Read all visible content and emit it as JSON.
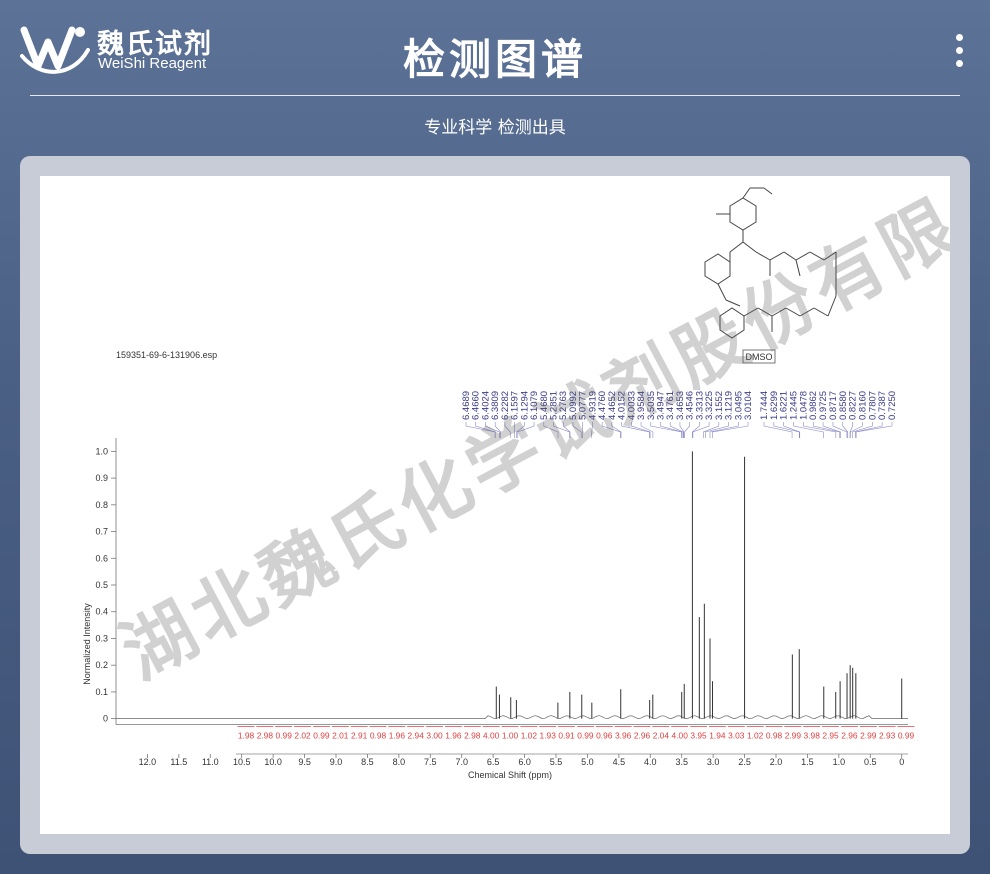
{
  "header": {
    "brand_cn": "魏氏试剂",
    "brand_en": "WeiShi Reagent",
    "title": "检测图谱",
    "subtitle": "专业科学  检测出具"
  },
  "watermark": "湖北魏氏化学试剂股份有限公司",
  "colors": {
    "accent_bg": "#4a5f84",
    "integral": "#e04040",
    "peak_label": "#3a3a8a",
    "spectrum": "#333333"
  },
  "chart_data": {
    "type": "line",
    "file_label": "159351-69-6-131906.esp",
    "xlabel": "Chemical Shift (ppm)",
    "ylabel": "Normalized Intensity",
    "xlim": [
      12.5,
      -0.1
    ],
    "ylim": [
      -0.05,
      1.05
    ],
    "x_ticks": [
      12.0,
      11.5,
      11.0,
      10.5,
      10.0,
      9.5,
      9.0,
      8.5,
      8.0,
      7.5,
      7.0,
      6.5,
      6.0,
      5.5,
      5.0,
      4.5,
      4.0,
      3.5,
      3.0,
      2.5,
      2.0,
      1.5,
      1.0,
      0.5,
      0
    ],
    "y_ticks": [
      0,
      0.1,
      0.2,
      0.3,
      0.4,
      0.5,
      0.6,
      0.7,
      0.8,
      0.9,
      1.0
    ],
    "solvent_label": "DMSO",
    "solvent_shift": 2.5,
    "peak_labels": [
      "6.4689",
      "6.4660",
      "6.4024",
      "6.3809",
      "6.2282",
      "6.1597",
      "6.1294",
      "6.1079",
      "5.4680",
      "5.2851",
      "5.2763",
      "5.0992",
      "5.0777",
      "4.9319",
      "4.4760",
      "4.4652",
      "4.0152",
      "4.0033",
      "3.9584",
      "3.5035",
      "3.4947",
      "3.4761",
      "3.4653",
      "3.4546",
      "3.3313",
      "3.3225",
      "3.1552",
      "3.1219",
      "3.0495",
      "3.0104",
      "1.7444",
      "1.6299",
      "1.6221",
      "1.2445",
      "1.0478",
      "0.9862",
      "0.9725",
      "0.8717",
      "0.8580",
      "0.8227",
      "0.8160",
      "0.7807",
      "0.7387",
      "0.7250"
    ],
    "integrals": [
      "1.98",
      "2.98",
      "0.99",
      "2.02",
      "0.99",
      "2.01",
      "2.91",
      "0.98",
      "1.96",
      "2.94",
      "3.00",
      "1.96",
      "2.98",
      "4.00",
      "1.00",
      "1.02",
      "1.93",
      "0.91",
      "0.99",
      "0.96",
      "3.96",
      "2.96",
      "2.04",
      "4.00",
      "3.95",
      "1.94",
      "3.03",
      "1.02",
      "0.98",
      "2.99",
      "3.98",
      "2.95",
      "2.96",
      "2.99",
      "2.93",
      "0.99"
    ],
    "peaks": [
      {
        "x": 6.45,
        "y": 0.12
      },
      {
        "x": 6.4,
        "y": 0.09
      },
      {
        "x": 6.22,
        "y": 0.08
      },
      {
        "x": 6.13,
        "y": 0.07
      },
      {
        "x": 5.47,
        "y": 0.06
      },
      {
        "x": 5.28,
        "y": 0.1
      },
      {
        "x": 5.09,
        "y": 0.09
      },
      {
        "x": 4.93,
        "y": 0.06
      },
      {
        "x": 4.47,
        "y": 0.11
      },
      {
        "x": 4.01,
        "y": 0.07
      },
      {
        "x": 3.96,
        "y": 0.09
      },
      {
        "x": 3.5,
        "y": 0.1
      },
      {
        "x": 3.46,
        "y": 0.13
      },
      {
        "x": 3.33,
        "y": 1.0
      },
      {
        "x": 3.22,
        "y": 0.38
      },
      {
        "x": 3.14,
        "y": 0.43
      },
      {
        "x": 3.05,
        "y": 0.3
      },
      {
        "x": 3.01,
        "y": 0.14
      },
      {
        "x": 2.5,
        "y": 0.98
      },
      {
        "x": 1.74,
        "y": 0.24
      },
      {
        "x": 1.63,
        "y": 0.26
      },
      {
        "x": 1.24,
        "y": 0.12
      },
      {
        "x": 1.05,
        "y": 0.1
      },
      {
        "x": 0.98,
        "y": 0.14
      },
      {
        "x": 0.87,
        "y": 0.17
      },
      {
        "x": 0.82,
        "y": 0.2
      },
      {
        "x": 0.78,
        "y": 0.19
      },
      {
        "x": 0.73,
        "y": 0.17
      },
      {
        "x": 0.0,
        "y": 0.15
      }
    ]
  }
}
